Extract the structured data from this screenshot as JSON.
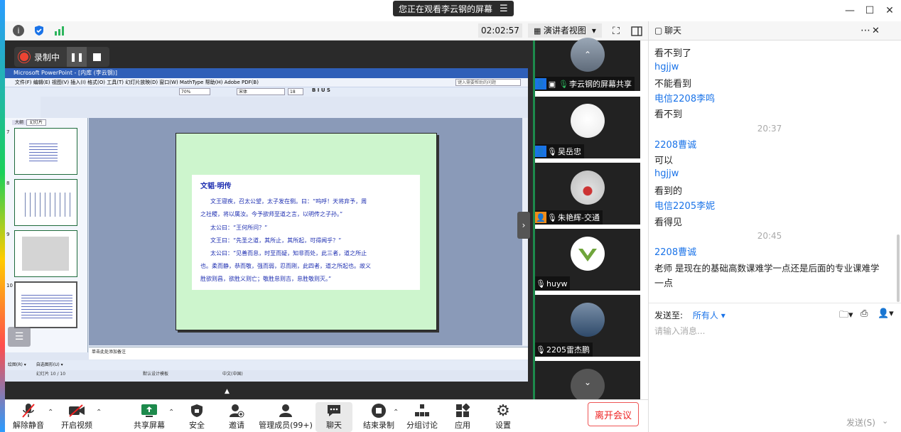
{
  "banner": {
    "text": "您正在观看李云钢的屏幕",
    "menu_icon": "hamburger-icon"
  },
  "window": {
    "minimize": "—",
    "maximize": "☐",
    "close": "✕"
  },
  "infobar": {
    "timer": "02:02:57",
    "view_label": "演讲者视图",
    "view_caret": "▾"
  },
  "recording": {
    "label": "录制中"
  },
  "ppt": {
    "title": "Microsoft PowerPoint - [内库 (李云钢)]",
    "menu": "文件(F)   编辑(E)   视图(V)   插入(I)   格式(O)   工具(T)   幻灯片放映(D)   窗口(W)   MathType   帮助(H)   Adobe PDF(B)",
    "zoom": "70%",
    "font": "宋体",
    "font_size": "18",
    "help_box": "键入需要帮助的问题",
    "side_tabs": [
      "大纲",
      "幻灯片"
    ],
    "thumb_numbers": [
      "7",
      "8",
      "9",
      "10"
    ],
    "slide": {
      "heading": "文韬·明传",
      "lines": [
        "文王寝疾，召太公望，太子发在侧。曰：“呜呼！天将弃予，周",
        "之社稷，将以属汝。今予欲师至道之言，以明传之子孙。”",
        "太公曰：“王何所问？”",
        "文王曰：“先圣之道，其所止，其所起，可得闻乎？”",
        "太公曰：“见善而怠，时至而疑，知非而处，此三者，道之所止",
        "也。柔而静，恭而敬，强而弱，忍而刚，此四者，道之所起也。故义",
        "胜欲则昌，欲胜义则亡；敬胜怠则吉，怠胜敬则灭。”"
      ]
    },
    "notes": "单击此处添加备注",
    "draw_label": "绘图(R) ▾",
    "autoshape": "自选图形(U) ▾",
    "status": {
      "slide_pos": "幻灯片 10 / 10",
      "design": "默认设计模板",
      "lang": "中文(中国)"
    }
  },
  "gallery": [
    {
      "name": "李云钢的屏幕共享",
      "avatar_color": "#8a95a3"
    },
    {
      "name": "吴岳忠",
      "avatar_color": "#e8e8e8"
    },
    {
      "name": "朱艳辉-交通",
      "avatar_color": "#cfcfcf"
    },
    {
      "name": "huyw",
      "avatar_color": "#ffffff"
    },
    {
      "name": "2205雷杰鹏",
      "avatar_color": "#5a7aa0"
    },
    {
      "name": "",
      "avatar_color": "#444444"
    }
  ],
  "chat": {
    "title": "聊天",
    "messages": [
      {
        "type": "text",
        "text": "看不到了"
      },
      {
        "type": "sender",
        "text": "hgjjw"
      },
      {
        "type": "text",
        "text": "不能看到"
      },
      {
        "type": "sender",
        "text": "电信2208李鸣"
      },
      {
        "type": "text",
        "text": "看不到"
      },
      {
        "type": "time",
        "text": "20:37"
      },
      {
        "type": "sender",
        "text": "2208曹诚"
      },
      {
        "type": "text",
        "text": "可以"
      },
      {
        "type": "sender",
        "text": "hgjjw"
      },
      {
        "type": "text",
        "text": "看到的"
      },
      {
        "type": "sender",
        "text": "电信2205李妮"
      },
      {
        "type": "text",
        "text": "看得见"
      },
      {
        "type": "time",
        "text": "20:45"
      },
      {
        "type": "sender",
        "text": "2208曹诚"
      },
      {
        "type": "text",
        "text": "老师 是现在的基础高数课难学一点还是后面的专业课难学"
      },
      {
        "type": "text",
        "text": "一点"
      }
    ],
    "send_to_label": "发送至:",
    "send_to_value": "所有人 ▾",
    "input_placeholder": "请输入消息...",
    "send_button": "发送(S)"
  },
  "toolbar": {
    "unmute": "解除静音",
    "start_video": "开启视频",
    "share_screen": "共享屏幕",
    "security": "安全",
    "invite": "邀请",
    "participants": "管理成员(99+)",
    "chat": "聊天",
    "end_recording": "结束录制",
    "breakout": "分组讨论",
    "apps": "应用",
    "settings": "设置",
    "leave": "离开会议"
  },
  "colors": {
    "accent_blue": "#1a73e8",
    "leave_red": "#e22222",
    "share_green": "#1d8a4c",
    "slide_text": "#1c2db0",
    "slide_bg": "#cdf5cd"
  }
}
